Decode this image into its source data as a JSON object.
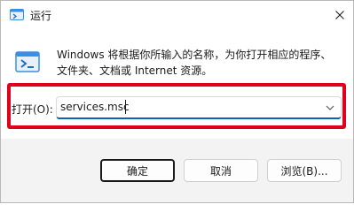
{
  "window": {
    "title": "运行",
    "close_glyph": "✕"
  },
  "content": {
    "description": "Windows 将根据你所输入的名称，为你打开相应的程序、\n文件夹、文档或 Internet 资源。",
    "open_label": "打开(O):",
    "command_value": "services.msc",
    "dropdown_glyph": "chevron-down-icon"
  },
  "buttons": {
    "ok_label": "确定",
    "cancel_label": "取消",
    "browse_label": "浏览(B)..."
  },
  "colors": {
    "accent": "#0067c0",
    "highlight_border": "#e0001b",
    "footer_bg": "#f3f3f3"
  }
}
